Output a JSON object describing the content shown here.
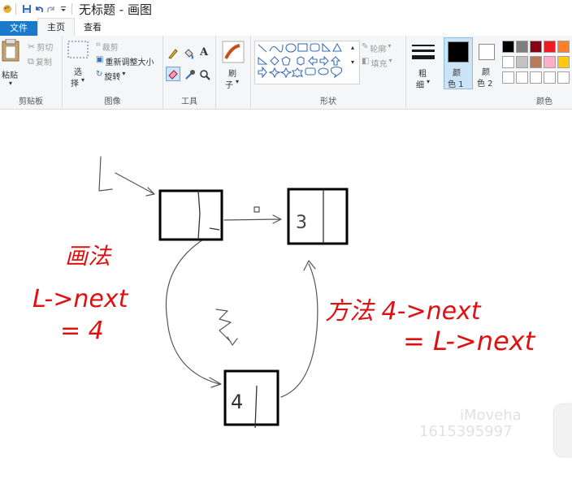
{
  "titlebar": {
    "title": "无标题 - 画图"
  },
  "tabs": {
    "file": "文件",
    "home": "主页",
    "view": "查看"
  },
  "clipboard": {
    "paste": "粘贴",
    "cut": "剪切",
    "copy": "复制",
    "label": "剪贴板"
  },
  "image": {
    "select_line1": "选",
    "select_line2": "择",
    "crop": "裁剪",
    "resize": "重新调整大小",
    "rotate": "旋转",
    "label": "图像"
  },
  "tools": {
    "label": "工具",
    "text_tool": "A"
  },
  "brushes": {
    "line1": "刷",
    "line2": "子"
  },
  "shapes": {
    "outline": "轮廓",
    "fill": "填充",
    "label": "形状"
  },
  "size": {
    "line1": "粗",
    "line2": "细"
  },
  "colors": {
    "color1_line1": "颜",
    "color1_line2": "色 1",
    "color2_line1": "颜",
    "color2_line2": "色 2",
    "label": "颜色",
    "color1_value": "#000000",
    "color2_value": "#ffffff",
    "palette_row1": [
      "#000000",
      "#7f7f7f",
      "#880015",
      "#ed1c24",
      "#ff7f27"
    ],
    "palette_row2": [
      "#ffffff",
      "#c3c3c3",
      "#b97a57",
      "#ffaec9",
      "#ffc90e"
    ],
    "palette_row3": [
      "#ffffff",
      "#ffffff",
      "#ffffff",
      "#ffffff",
      "#ffffff"
    ]
  },
  "drawing": {
    "node_left_label": "",
    "node_right_label": "3",
    "node_bottom_label": "4",
    "red_note_left_line1": "画法",
    "red_note_left_line2": "L->next",
    "red_note_left_line3": "= 4",
    "red_note_right_line1": "方法 4->next",
    "red_note_right_line2": "= L->next",
    "accent_red": "#e01010"
  },
  "watermark": {
    "line1": "iMoveha",
    "line2": "1615395997"
  }
}
